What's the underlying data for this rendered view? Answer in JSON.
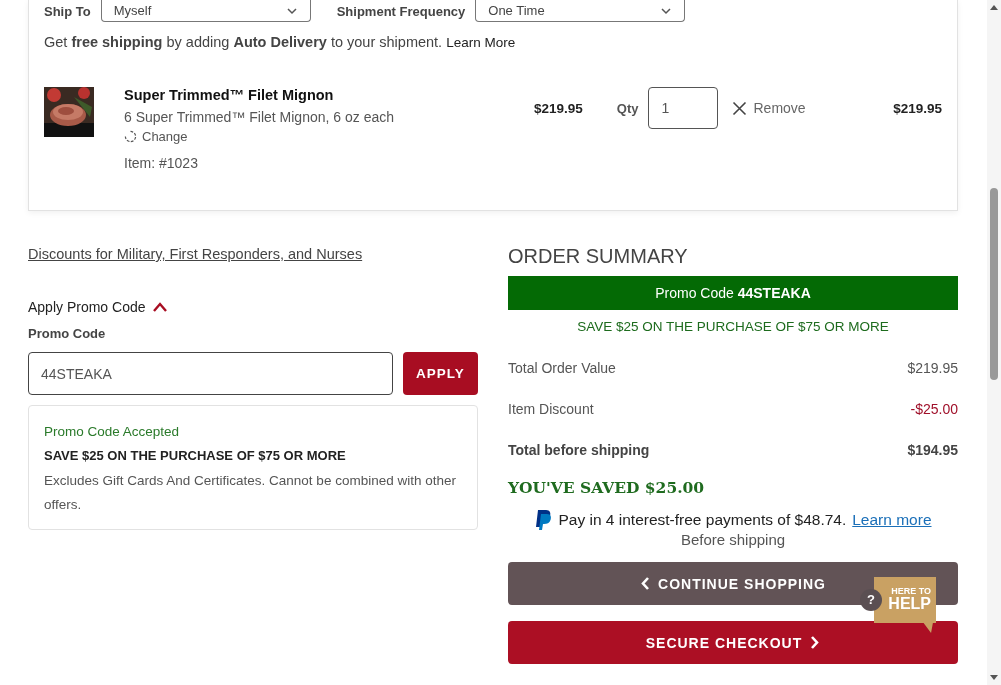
{
  "shipping_options": [
    {
      "label": "Ship To",
      "value": "Myself"
    },
    {
      "label": "Shipment Frequency",
      "value": "One Time"
    }
  ],
  "auto_delivery_note": "Get **free shipping** by adding **Auto Delivery** to your shipment.",
  "auto_delivery_link": "Learn More",
  "cart_items": [
    {
      "name": "Super Trimmed™ Filet Mignon",
      "description": "6 Super Trimmed™ Filet Mignon, 6 oz each",
      "change": "Change",
      "item_number": "Item: #1023",
      "price": "$219.95",
      "qty_label": "Qty",
      "qty": "1",
      "remove": "Remove",
      "total": "$219.95"
    }
  ],
  "discounts_link": "Discounts for Military, First Responders, and Nurses",
  "promo": {
    "toggle": "Apply Promo Code",
    "expanded": true,
    "label": "Promo Code",
    "value": "44STEAKA",
    "apply": "APPLY",
    "status": "Promo Code Accepted",
    "offer": "SAVE $25 ON THE PURCHASE OF $75 OR MORE",
    "terms": "Excludes Gift Cards And Certificates. Cannot be combined with other offers."
  },
  "summary": {
    "title": "ORDER SUMMARY",
    "promo_banner": "Promo Code **44STEAKA**",
    "promo_offer": "SAVE $25 ON THE PURCHASE OF $75 OR MORE",
    "lines": [
      {
        "label": "Total Order Value",
        "value": "$219.95",
        "kind": "normal"
      },
      {
        "label": "Item Discount",
        "value": "-$25.00",
        "kind": "discount"
      },
      {
        "label": "Total before shipping",
        "value": "$194.95",
        "kind": "total"
      }
    ],
    "saved": "YOU'VE SAVED $25.00",
    "paypal_text": "Pay in 4 interest-free payments of $48.74.",
    "paypal_link": "Learn more",
    "paypal_note": "Before shipping",
    "continue": "CONTINUE SHOPPING",
    "checkout": "SECURE CHECKOUT"
  },
  "help_widget": {
    "icon": "?",
    "line1": "HERE TO",
    "line2": "HELP"
  }
}
